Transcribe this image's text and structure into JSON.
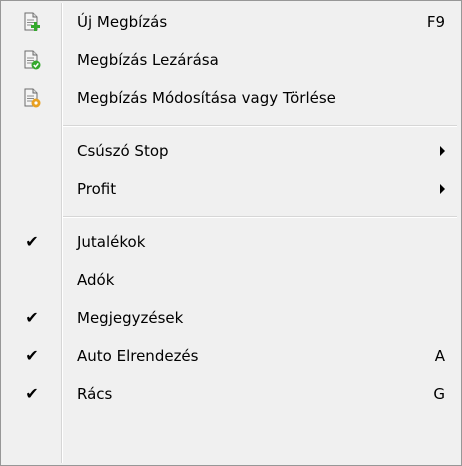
{
  "menu": {
    "items": [
      {
        "label": "Új Megbízás",
        "shortcut": "F9",
        "icon": "new-order-icon"
      },
      {
        "label": "Megbízás Lezárása",
        "shortcut": "",
        "icon": "close-order-icon"
      },
      {
        "label": "Megbízás Módosítása vagy Törlése",
        "shortcut": "",
        "icon": "modify-order-icon"
      },
      {
        "label": "Csúszó Stop",
        "submenu": true
      },
      {
        "label": "Profit",
        "submenu": true
      },
      {
        "label": "Jutalékok",
        "checked": true
      },
      {
        "label": "Adók",
        "checked": false
      },
      {
        "label": "Megjegyzések",
        "checked": true
      },
      {
        "label": "Auto Elrendezés",
        "checked": true,
        "shortcut": "A"
      },
      {
        "label": "Rács",
        "checked": true,
        "shortcut": "G"
      }
    ],
    "check_glyph": "✔",
    "colors": {
      "background": "#f0f0f0",
      "border": "#979797",
      "separator": "#d6d6d6",
      "icon_green": "#35a82e",
      "icon_orange": "#e8a021"
    }
  }
}
